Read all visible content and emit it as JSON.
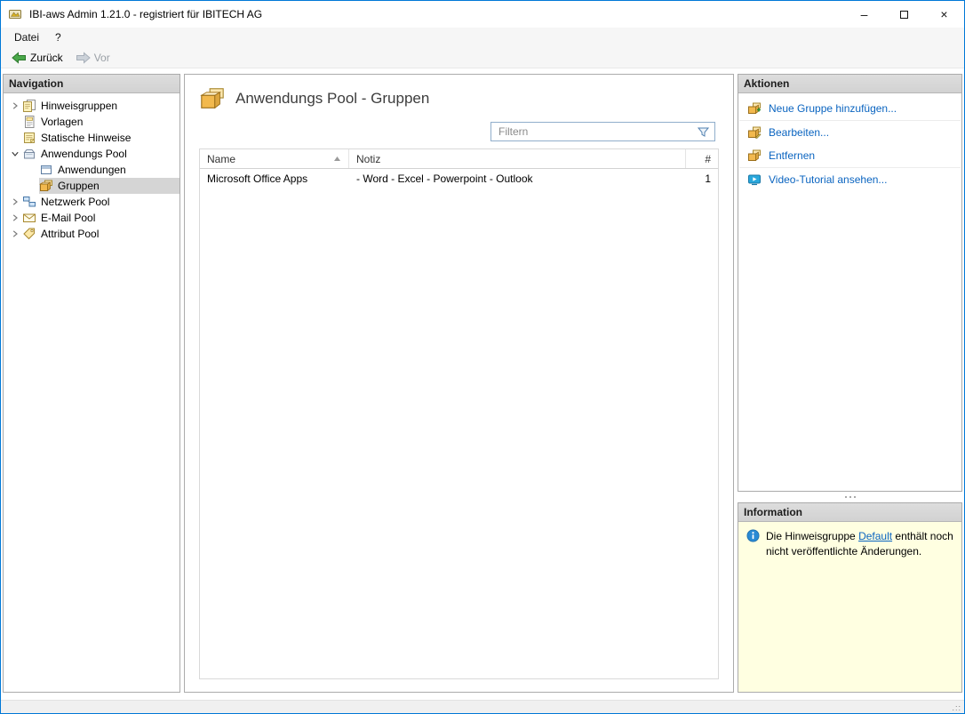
{
  "window": {
    "title": "IBI-aws Admin 1.21.0 - registriert für IBITECH AG",
    "controls": {
      "minimize": "–",
      "close": "×"
    }
  },
  "menubar": {
    "items": [
      {
        "label": "Datei"
      },
      {
        "label": "?"
      }
    ]
  },
  "toolbar": {
    "back": "Zurück",
    "forward": "Vor"
  },
  "navigation": {
    "header": "Navigation",
    "items": [
      {
        "label": "Hinweisgruppen"
      },
      {
        "label": "Vorlagen"
      },
      {
        "label": "Statische Hinweise"
      },
      {
        "label": "Anwendungs Pool"
      },
      {
        "label": "Anwendungen"
      },
      {
        "label": "Gruppen"
      },
      {
        "label": "Netzwerk Pool"
      },
      {
        "label": "E-Mail Pool"
      },
      {
        "label": "Attribut Pool"
      }
    ]
  },
  "main": {
    "title": "Anwendungs Pool - Gruppen",
    "filter_placeholder": "Filtern",
    "table": {
      "columns": {
        "name": "Name",
        "note": "Notiz",
        "count": "#"
      },
      "rows": [
        {
          "name": "Microsoft Office Apps",
          "note": "- Word - Excel - Powerpoint - Outlook",
          "count": "1"
        }
      ]
    }
  },
  "actions": {
    "header": "Aktionen",
    "items": [
      {
        "label": "Neue Gruppe hinzufügen..."
      },
      {
        "label": "Bearbeiten..."
      },
      {
        "label": "Entfernen"
      },
      {
        "label": "Video-Tutorial ansehen..."
      }
    ]
  },
  "information": {
    "header": "Information",
    "text_before": "Die Hinweisgruppe ",
    "link_text": "Default",
    "text_after": " enthält noch nicht veröffentlichte Änderungen."
  },
  "statusbar": {
    "resize_grip": ".::"
  },
  "colors": {
    "window_border": "#0078d7",
    "link": "#0a64c0",
    "info_background": "#ffffe1",
    "panel_header_background": "#d6d6d6",
    "selected_tree_item": "#d5d5d5",
    "back_arrow_green": "#4aa84a"
  }
}
